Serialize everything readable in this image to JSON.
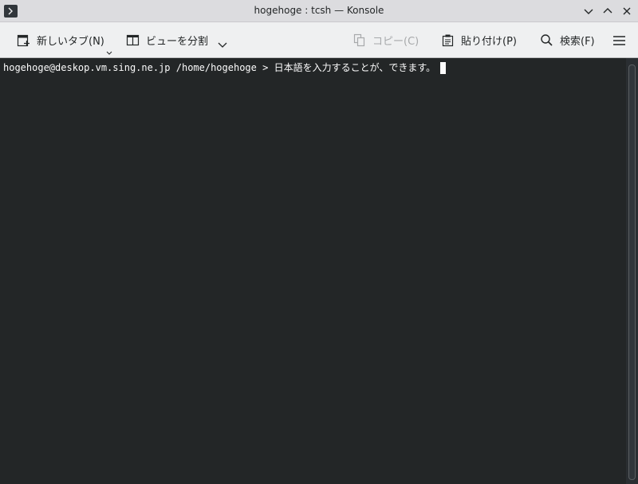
{
  "window": {
    "title": "hogehoge : tcsh — Konsole"
  },
  "toolbar": {
    "new_tab": "新しいタブ(N)",
    "split_view": "ビューを分割",
    "copy": "コピー(C)",
    "paste": "貼り付け(P)",
    "find": "検索(F)"
  },
  "terminal": {
    "prompt": "hogehoge@deskop.vm.sing.ne.jp /home/hogehoge > ",
    "input": "日本語を入力することが、できます。"
  },
  "icons": {
    "app": "terminal-icon",
    "minimize": "chevron-down-icon",
    "maximize": "chevron-up-icon",
    "close": "close-icon",
    "new_tab": "new-tab-icon",
    "split": "split-view-icon",
    "copy": "copy-icon",
    "paste": "paste-icon",
    "find": "search-icon",
    "menu": "hamburger-menu-icon"
  },
  "colors": {
    "terminal_bg": "#232627",
    "terminal_fg": "#fcfcfc",
    "toolbar_bg": "#eff0f1",
    "titlebar_bg": "#dcdcdf"
  }
}
